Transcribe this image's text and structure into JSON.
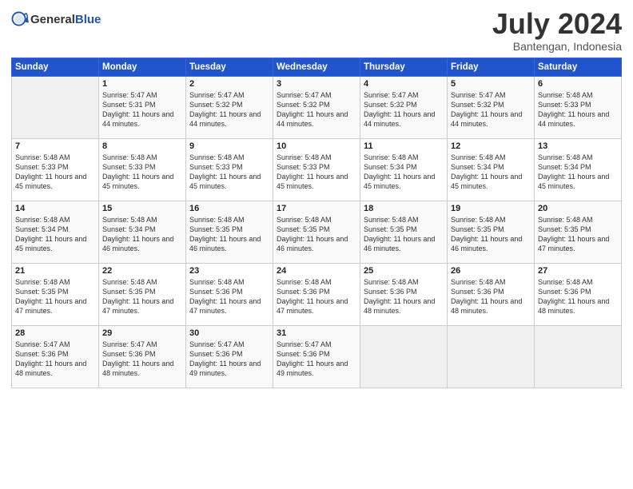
{
  "header": {
    "logo_general": "General",
    "logo_blue": "Blue",
    "month": "July 2024",
    "location": "Bantengan, Indonesia"
  },
  "weekdays": [
    "Sunday",
    "Monday",
    "Tuesday",
    "Wednesday",
    "Thursday",
    "Friday",
    "Saturday"
  ],
  "weeks": [
    [
      {
        "day": "",
        "info": ""
      },
      {
        "day": "1",
        "info": "Sunrise: 5:47 AM\nSunset: 5:31 PM\nDaylight: 11 hours and 44 minutes."
      },
      {
        "day": "2",
        "info": "Sunrise: 5:47 AM\nSunset: 5:32 PM\nDaylight: 11 hours and 44 minutes."
      },
      {
        "day": "3",
        "info": "Sunrise: 5:47 AM\nSunset: 5:32 PM\nDaylight: 11 hours and 44 minutes."
      },
      {
        "day": "4",
        "info": "Sunrise: 5:47 AM\nSunset: 5:32 PM\nDaylight: 11 hours and 44 minutes."
      },
      {
        "day": "5",
        "info": "Sunrise: 5:47 AM\nSunset: 5:32 PM\nDaylight: 11 hours and 44 minutes."
      },
      {
        "day": "6",
        "info": "Sunrise: 5:48 AM\nSunset: 5:33 PM\nDaylight: 11 hours and 44 minutes."
      }
    ],
    [
      {
        "day": "7",
        "info": "Sunrise: 5:48 AM\nSunset: 5:33 PM\nDaylight: 11 hours and 45 minutes."
      },
      {
        "day": "8",
        "info": "Sunrise: 5:48 AM\nSunset: 5:33 PM\nDaylight: 11 hours and 45 minutes."
      },
      {
        "day": "9",
        "info": "Sunrise: 5:48 AM\nSunset: 5:33 PM\nDaylight: 11 hours and 45 minutes."
      },
      {
        "day": "10",
        "info": "Sunrise: 5:48 AM\nSunset: 5:33 PM\nDaylight: 11 hours and 45 minutes."
      },
      {
        "day": "11",
        "info": "Sunrise: 5:48 AM\nSunset: 5:34 PM\nDaylight: 11 hours and 45 minutes."
      },
      {
        "day": "12",
        "info": "Sunrise: 5:48 AM\nSunset: 5:34 PM\nDaylight: 11 hours and 45 minutes."
      },
      {
        "day": "13",
        "info": "Sunrise: 5:48 AM\nSunset: 5:34 PM\nDaylight: 11 hours and 45 minutes."
      }
    ],
    [
      {
        "day": "14",
        "info": "Sunrise: 5:48 AM\nSunset: 5:34 PM\nDaylight: 11 hours and 45 minutes."
      },
      {
        "day": "15",
        "info": "Sunrise: 5:48 AM\nSunset: 5:34 PM\nDaylight: 11 hours and 46 minutes."
      },
      {
        "day": "16",
        "info": "Sunrise: 5:48 AM\nSunset: 5:35 PM\nDaylight: 11 hours and 46 minutes."
      },
      {
        "day": "17",
        "info": "Sunrise: 5:48 AM\nSunset: 5:35 PM\nDaylight: 11 hours and 46 minutes."
      },
      {
        "day": "18",
        "info": "Sunrise: 5:48 AM\nSunset: 5:35 PM\nDaylight: 11 hours and 46 minutes."
      },
      {
        "day": "19",
        "info": "Sunrise: 5:48 AM\nSunset: 5:35 PM\nDaylight: 11 hours and 46 minutes."
      },
      {
        "day": "20",
        "info": "Sunrise: 5:48 AM\nSunset: 5:35 PM\nDaylight: 11 hours and 47 minutes."
      }
    ],
    [
      {
        "day": "21",
        "info": "Sunrise: 5:48 AM\nSunset: 5:35 PM\nDaylight: 11 hours and 47 minutes."
      },
      {
        "day": "22",
        "info": "Sunrise: 5:48 AM\nSunset: 5:35 PM\nDaylight: 11 hours and 47 minutes."
      },
      {
        "day": "23",
        "info": "Sunrise: 5:48 AM\nSunset: 5:36 PM\nDaylight: 11 hours and 47 minutes."
      },
      {
        "day": "24",
        "info": "Sunrise: 5:48 AM\nSunset: 5:36 PM\nDaylight: 11 hours and 47 minutes."
      },
      {
        "day": "25",
        "info": "Sunrise: 5:48 AM\nSunset: 5:36 PM\nDaylight: 11 hours and 48 minutes."
      },
      {
        "day": "26",
        "info": "Sunrise: 5:48 AM\nSunset: 5:36 PM\nDaylight: 11 hours and 48 minutes."
      },
      {
        "day": "27",
        "info": "Sunrise: 5:48 AM\nSunset: 5:36 PM\nDaylight: 11 hours and 48 minutes."
      }
    ],
    [
      {
        "day": "28",
        "info": "Sunrise: 5:47 AM\nSunset: 5:36 PM\nDaylight: 11 hours and 48 minutes."
      },
      {
        "day": "29",
        "info": "Sunrise: 5:47 AM\nSunset: 5:36 PM\nDaylight: 11 hours and 48 minutes."
      },
      {
        "day": "30",
        "info": "Sunrise: 5:47 AM\nSunset: 5:36 PM\nDaylight: 11 hours and 49 minutes."
      },
      {
        "day": "31",
        "info": "Sunrise: 5:47 AM\nSunset: 5:36 PM\nDaylight: 11 hours and 49 minutes."
      },
      {
        "day": "",
        "info": ""
      },
      {
        "day": "",
        "info": ""
      },
      {
        "day": "",
        "info": ""
      }
    ]
  ]
}
